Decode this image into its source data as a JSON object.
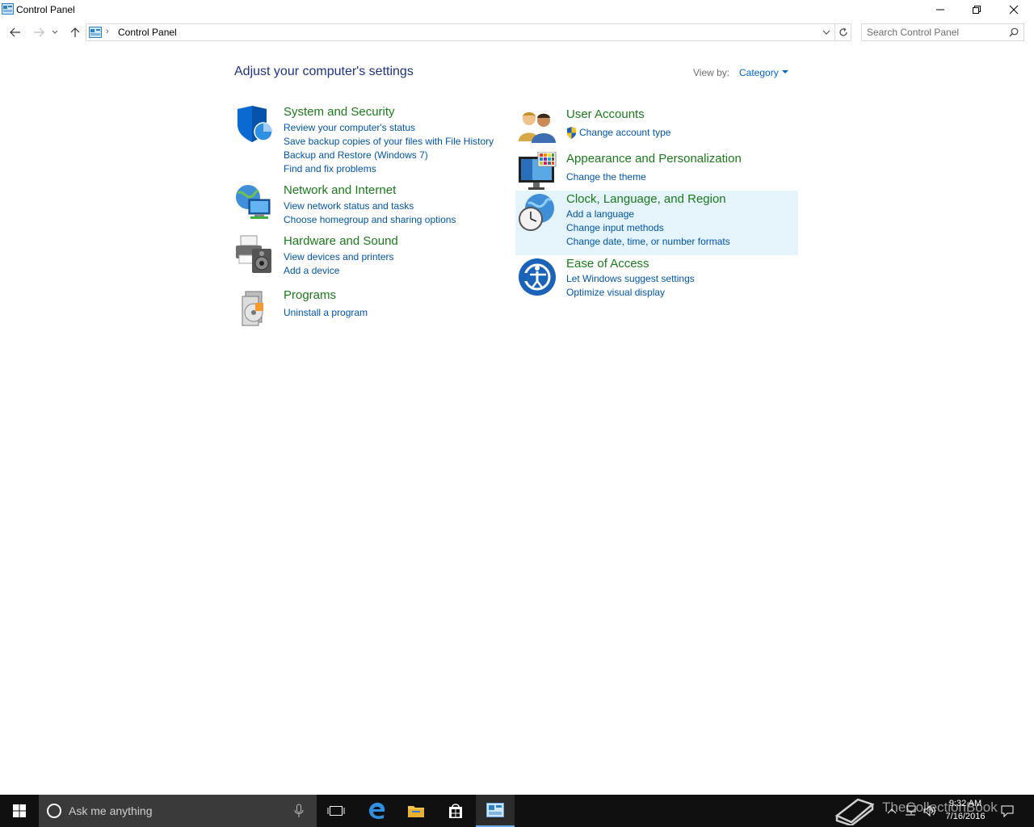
{
  "window": {
    "title": "Control Panel"
  },
  "address_bar": {
    "breadcrumb": "Control Panel",
    "search_placeholder": "Search Control Panel"
  },
  "main": {
    "heading": "Adjust your computer's settings",
    "view_by_label": "View by:",
    "view_by_value": "Category"
  },
  "categories_left": [
    {
      "title": "System and Security",
      "icon": "shield-icon",
      "links": [
        "Review your computer's status",
        "Save backup copies of your files with File History",
        "Backup and Restore (Windows 7)",
        "Find and fix problems"
      ]
    },
    {
      "title": "Network and Internet",
      "icon": "network-globe-icon",
      "links": [
        "View network status and tasks",
        "Choose homegroup and sharing options"
      ]
    },
    {
      "title": "Hardware and Sound",
      "icon": "printer-speaker-icon",
      "links": [
        "View devices and printers",
        "Add a device"
      ]
    },
    {
      "title": "Programs",
      "icon": "programs-disc-icon",
      "links": [
        "Uninstall a program"
      ]
    }
  ],
  "categories_right": [
    {
      "title": "User Accounts",
      "icon": "users-icon",
      "links": [
        "Change account type"
      ]
    },
    {
      "title": "Appearance and Personalization",
      "icon": "monitor-palette-icon",
      "links": [
        "Change the theme"
      ]
    },
    {
      "title": "Clock, Language, and Region",
      "icon": "clock-globe-icon",
      "links": [
        "Add a language",
        "Change input methods",
        "Change date, time, or number formats"
      ],
      "highlighted": true
    },
    {
      "title": "Ease of Access",
      "icon": "ease-of-access-icon",
      "links": [
        "Let Windows suggest settings",
        "Optimize visual display"
      ]
    }
  ],
  "taskbar": {
    "search_text": "Ask me anything",
    "watermark": "TheCollectionBook",
    "time": "9:32 AM",
    "date": "7/16/2016"
  },
  "colors": {
    "heading": "#1e3287",
    "category_title": "#1b7a1b",
    "link": "#0055aa",
    "highlight": "#e5f3fb",
    "taskbar": "#101010"
  }
}
